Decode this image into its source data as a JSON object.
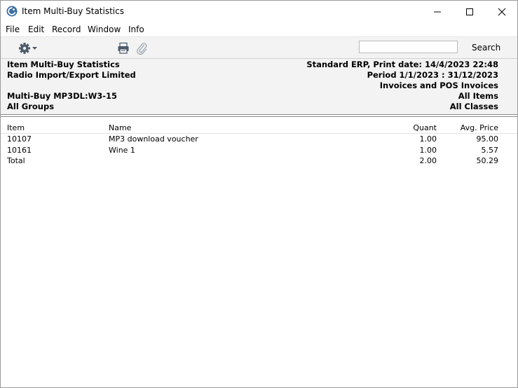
{
  "window": {
    "title": "Item Multi-Buy Statistics"
  },
  "menu": [
    "File",
    "Edit",
    "Record",
    "Window",
    "Info"
  ],
  "toolbar": {
    "search_placeholder": "",
    "search_label": "Search"
  },
  "report_header": {
    "left": {
      "line1": "Item Multi-Buy Statistics",
      "line2": "Radio Import/Export Limited",
      "line4": "Multi-Buy MP3DL:W3-15",
      "line5": "All Groups"
    },
    "right": {
      "line1": "Standard ERP, Print date:  14/4/2023 22:48",
      "line2": "Period  1/1/2023 : 31/12/2023",
      "line3": "Invoices and POS Invoices",
      "line4": "All Items",
      "line5": "All Classes"
    }
  },
  "table": {
    "columns": {
      "item": "Item",
      "name": "Name",
      "quant": "Quant",
      "avg_price": "Avg. Price"
    },
    "rows": [
      {
        "item": "10107",
        "name": "MP3 download voucher",
        "quant": "1.00",
        "avg_price": "95.00"
      },
      {
        "item": "10161",
        "name": "Wine 1",
        "quant": "1.00",
        "avg_price": "5.57"
      }
    ],
    "total": {
      "label": "Total",
      "quant": "2.00",
      "avg_price": "50.29"
    }
  }
}
